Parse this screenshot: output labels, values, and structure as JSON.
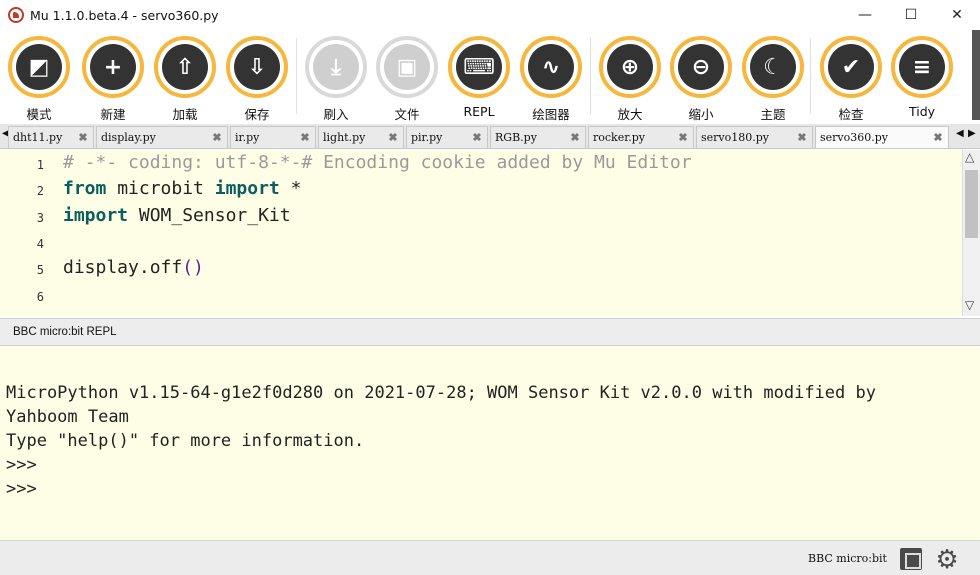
{
  "window": {
    "title": "Mu 1.1.0.beta.4 - servo360.py",
    "minimize_glyph": "—",
    "maximize_glyph": "☐",
    "close_glyph": "✕"
  },
  "toolbar": {
    "buttons": [
      {
        "label": "模式",
        "icon": "mode-icon",
        "glyph": "◩",
        "enabled": true
      },
      {
        "label": "新建",
        "icon": "plus-icon",
        "glyph": "+",
        "enabled": true
      },
      {
        "label": "加载",
        "icon": "upload-icon",
        "glyph": "⇧",
        "enabled": true
      },
      {
        "label": "保存",
        "icon": "download-icon",
        "glyph": "⇩",
        "enabled": true
      },
      {
        "label": "刷入",
        "icon": "flash-icon",
        "glyph": "⤓",
        "enabled": false
      },
      {
        "label": "文件",
        "icon": "files-icon",
        "glyph": "▣",
        "enabled": false
      },
      {
        "label": "REPL",
        "icon": "keyboard-icon",
        "glyph": "⌨",
        "enabled": true
      },
      {
        "label": "绘图器",
        "icon": "pulse-icon",
        "glyph": "∿",
        "enabled": true
      },
      {
        "label": "放大",
        "icon": "zoom-in-icon",
        "glyph": "⊕",
        "enabled": true
      },
      {
        "label": "缩小",
        "icon": "zoom-out-icon",
        "glyph": "⊖",
        "enabled": true
      },
      {
        "label": "主题",
        "icon": "moon-icon",
        "glyph": "☾",
        "enabled": true
      },
      {
        "label": "检查",
        "icon": "thumbs-up-icon",
        "glyph": "✔",
        "enabled": true
      },
      {
        "label": "Tidy",
        "icon": "menu-lines-icon",
        "glyph": "≡",
        "enabled": true
      }
    ]
  },
  "tabs": {
    "items": [
      {
        "label": "dht11.py",
        "active": false
      },
      {
        "label": "display.py",
        "active": false
      },
      {
        "label": "ir.py",
        "active": false
      },
      {
        "label": "light.py",
        "active": false
      },
      {
        "label": "pir.py",
        "active": false
      },
      {
        "label": "RGB.py",
        "active": false
      },
      {
        "label": "rocker.py",
        "active": false
      },
      {
        "label": "servo180.py",
        "active": false
      },
      {
        "label": "servo360.py",
        "active": true
      }
    ],
    "close_glyph": "✖",
    "left_arrow": "◀",
    "right_arrow": "▶"
  },
  "editor": {
    "line_numbers": [
      "1",
      "2",
      "3",
      "4",
      "5",
      "6"
    ],
    "lines": [
      {
        "parts": [
          {
            "t": "# -*- coding: utf-8-*-# Encoding cookie added by Mu Editor",
            "c": "cm"
          }
        ]
      },
      {
        "parts": [
          {
            "t": "from",
            "c": "kw"
          },
          {
            "t": " microbit ",
            "c": "fn"
          },
          {
            "t": "import",
            "c": "kw"
          },
          {
            "t": " *",
            "c": "fn"
          }
        ]
      },
      {
        "parts": [
          {
            "t": "import",
            "c": "kw"
          },
          {
            "t": " WOM_Sensor_Kit",
            "c": "fn"
          }
        ]
      },
      {
        "parts": []
      },
      {
        "parts": [
          {
            "t": "display.off",
            "c": "fn"
          },
          {
            "t": "()",
            "c": "paren"
          }
        ]
      },
      {
        "parts": []
      }
    ],
    "scroll_up": "△",
    "scroll_down": "▽"
  },
  "repl": {
    "title": "BBC micro:bit REPL",
    "lines": [
      "",
      "MicroPython v1.15-64-g1e2f0d280 on 2021-07-28; WOM Sensor Kit v2.0.0 with modified by",
      "Yahboom Team",
      "Type \"help()\" for more information.",
      ">>>",
      ">>>"
    ]
  },
  "status": {
    "mode": "BBC micro:bit",
    "gear_glyph": "⚙"
  },
  "colors": {
    "button_ring": "#f6b73c",
    "button_inner": "#333333",
    "editor_bg": "#fefee6",
    "keyword": "#0b5e5e",
    "comment": "#9a9a9a"
  }
}
